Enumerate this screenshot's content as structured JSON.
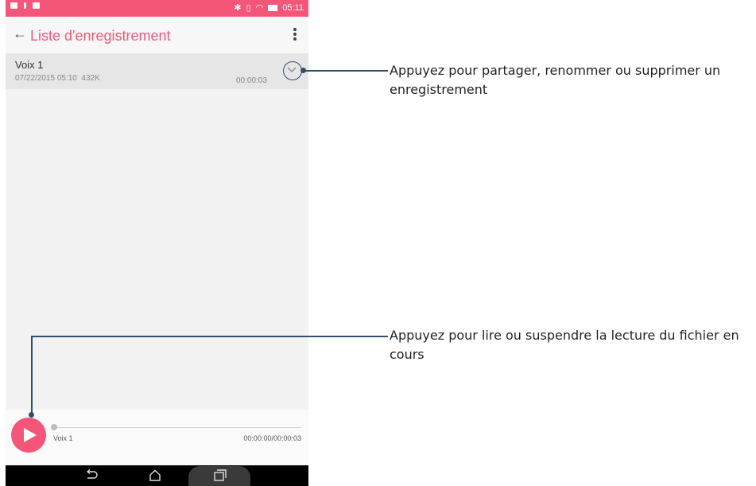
{
  "status_bar": {
    "time": "05:11"
  },
  "app_bar": {
    "back_icon": "arrow-left-icon",
    "title": "Liste d'enregistrement",
    "menu_icon": "more-vertical-icon"
  },
  "recordings": [
    {
      "name": "Voix 1",
      "date": "07/22/2015 05:10",
      "size": "432K",
      "duration": "00:00:03"
    }
  ],
  "player": {
    "track_name": "Voix 1",
    "time": "00:00:00/00:00:03",
    "progress": 0
  },
  "nav": {
    "back": "back-icon",
    "home": "home-icon",
    "recents": "recents-icon"
  },
  "callouts": {
    "top": "Appuyez pour partager, renommer ou supprimer un enregistrement",
    "bottom": "Appuyez pour lire ou suspendre la lecture du fichier en cours"
  },
  "colors": {
    "accent": "#f4567a",
    "callout_line": "#2f4f6f"
  }
}
